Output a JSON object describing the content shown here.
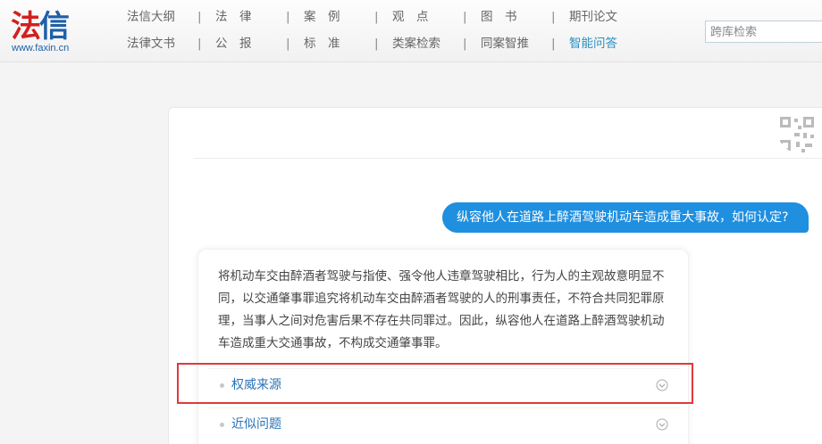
{
  "brand": {
    "logo_part1": "法",
    "logo_part2": "信",
    "url": "www.faxin.cn"
  },
  "nav": {
    "row1": [
      "法信大纲",
      "法　律",
      "案　例",
      "观　点",
      "图　书",
      "期刊论文"
    ],
    "row2": [
      "法律文书",
      "公　报",
      "标　准",
      "类案检索",
      "同案智推",
      "智能问答"
    ],
    "separator": "|",
    "active": "智能问答"
  },
  "search": {
    "placeholder": "跨库检索",
    "value": ""
  },
  "chat": {
    "question": "纵容他人在道路上醉酒驾驶机动车造成重大事故，如何认定?",
    "answer": "将机动车交由醉酒者驾驶与指使、强令他人违章驾驶相比，行为人的主观故意明显不同，以交通肇事罪追究将机动车交由醉酒者驾驶的人的刑事责任，不符合共同犯罪原理，当事人之间对危害后果不存在共同罪过。因此，纵容他人在道路上醉酒驾驶机动车造成重大交通事故，不构成交通肇事罪。",
    "sections": [
      {
        "label": "权威来源",
        "icon": "chevron-down-icon"
      },
      {
        "label": "近似问题",
        "icon": "chevron-down-icon"
      }
    ]
  },
  "colors": {
    "accent": "#1f8fe0",
    "link": "#2a73b5",
    "highlight": "#e0393b",
    "logo_red": "#d2201f",
    "logo_blue": "#1e5fa8"
  }
}
